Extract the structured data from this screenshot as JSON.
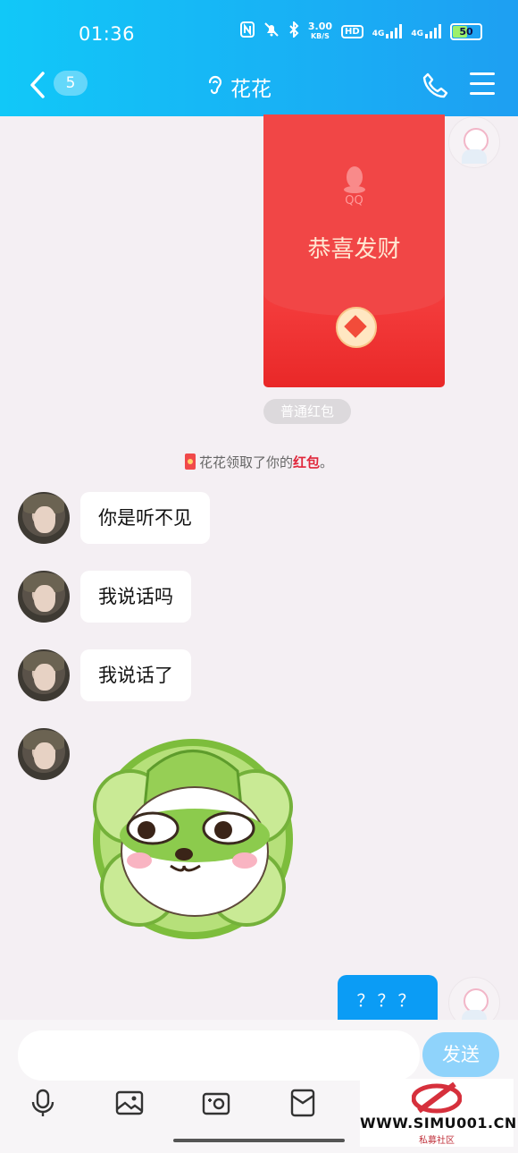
{
  "status_bar": {
    "time": "01:36",
    "speed": "3.00",
    "speed_unit": "KB/S",
    "hd_label": "HD",
    "net1": "4G",
    "net2": "4G",
    "battery": "50"
  },
  "header": {
    "unread_count": "5",
    "title": "花花",
    "accent_color": "#1ea3f3"
  },
  "red_packet": {
    "brand": "QQ",
    "greeting": "恭喜发财",
    "label": "普通红包"
  },
  "notice": {
    "prefix": "花花领取了你的",
    "highlight": "红包",
    "suffix": "。"
  },
  "messages": [
    {
      "side": "left",
      "text": "你是听不见"
    },
    {
      "side": "left",
      "text": "我说话吗"
    },
    {
      "side": "left",
      "text": "我说话了"
    }
  ],
  "my_message": {
    "text": "？？？"
  },
  "input": {
    "placeholder": "",
    "send_label": "发送"
  },
  "watermark": {
    "text": "WWW.SIMU001.CN",
    "sub": "私募社区"
  }
}
